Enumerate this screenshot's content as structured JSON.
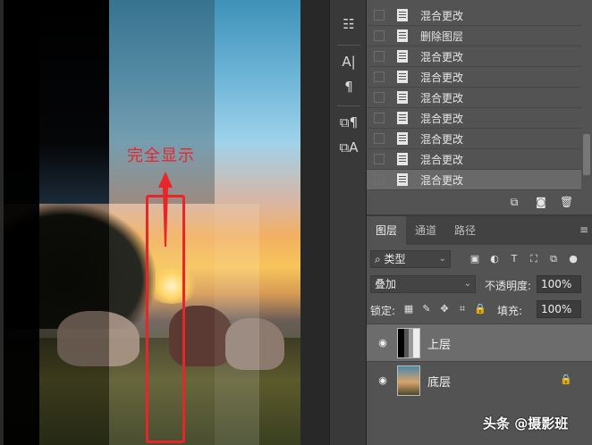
{
  "canvas": {
    "annotation_text": "完全显示",
    "annotation_color": "#e8262a"
  },
  "toolbar": {
    "tools": [
      {
        "name": "stamp-tool",
        "glyph": "☷"
      },
      {
        "name": "type-tool",
        "glyph": "A|"
      },
      {
        "name": "paragraph-tool",
        "glyph": "¶"
      },
      {
        "name": "char-style-tool",
        "glyph": "⧉¶"
      },
      {
        "name": "para-style-tool",
        "glyph": "⧉A"
      }
    ]
  },
  "history": {
    "items": [
      {
        "label": "混合更改",
        "selected": false
      },
      {
        "label": "删除图层",
        "selected": false
      },
      {
        "label": "混合更改",
        "selected": false
      },
      {
        "label": "混合更改",
        "selected": false
      },
      {
        "label": "混合更改",
        "selected": false
      },
      {
        "label": "混合更改",
        "selected": false
      },
      {
        "label": "混合更改",
        "selected": false
      },
      {
        "label": "混合更改",
        "selected": false
      },
      {
        "label": "混合更改",
        "selected": true
      }
    ]
  },
  "layers_panel": {
    "tabs": [
      {
        "label": "图层",
        "active": true
      },
      {
        "label": "通道",
        "active": false
      },
      {
        "label": "路径",
        "active": false
      }
    ],
    "filter_kind": "类型",
    "blend_mode": "叠加",
    "opacity_label": "不透明度:",
    "opacity_value": "100%",
    "lock_label": "锁定:",
    "fill_label": "填充:",
    "fill_value": "100%",
    "layers": [
      {
        "name": "上层",
        "selected": true,
        "locked": false
      },
      {
        "name": "底层",
        "selected": false,
        "locked": true
      }
    ]
  },
  "watermark": "头条 @摄影班"
}
